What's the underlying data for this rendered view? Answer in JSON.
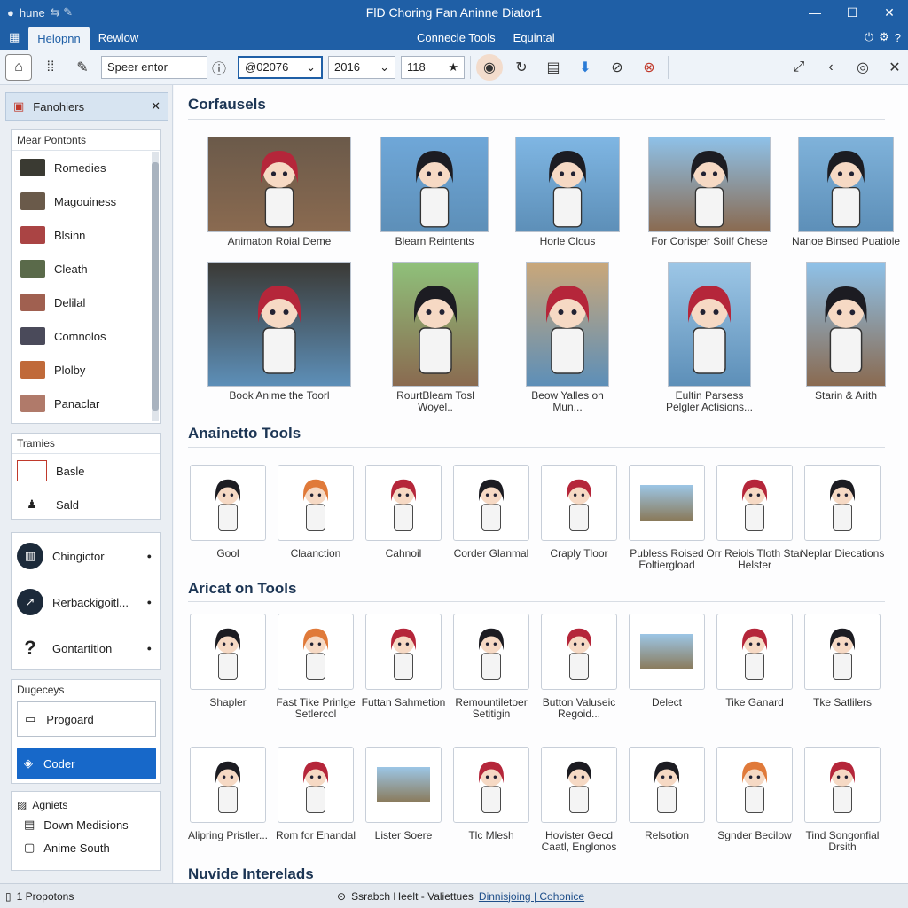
{
  "titlebar": {
    "app_label": "hune",
    "title": "FlD Choring Fan Aninne Diator1"
  },
  "menubar": {
    "tabs": [
      "Helopnn",
      "Rewlow"
    ],
    "center_items": [
      "Connecle Tools",
      "Equintal"
    ]
  },
  "toolbar": {
    "search_value": "Speer entor",
    "select1_value": "@02076",
    "select2_value": "2016",
    "number_value": "118"
  },
  "sidebar": {
    "top_title": "Fanohiers",
    "panel1_title": "Mear Pontonts",
    "panel1_items": [
      "Romedies",
      "Magouiness",
      "Blsinn",
      "Cleath",
      "Delilal",
      "Comnolos",
      "Plolby",
      "Panaclar"
    ],
    "panel2_title": "Tramies",
    "panel2_items": [
      "Basle",
      "Sald"
    ],
    "panel3_items": [
      "Chingictor",
      "Rerbackigoitl...",
      "Gontartition"
    ],
    "panel4_title": "Dugeceys",
    "panel4_buttons": [
      "Progoard",
      "Coder"
    ],
    "panel5_title": "Agniets",
    "panel5_items": [
      "Down Medisions",
      "Anime South"
    ]
  },
  "main": {
    "section1_title": "Corfausels",
    "section1_cards": [
      "Animaton Roial Deme",
      "Blearn Reintents",
      "Horle Clous",
      "For Corisper Soilf Chese",
      "Nanoe Binsed Puatiole",
      "Book Anime the Toorl",
      "RourtBleam Tosl Woyel..",
      "Beow Yalles on Mun...",
      "Eultin Parsess Pelgler Actisions...",
      "Starin & Arith"
    ],
    "section2_title": "Anainetto Tools",
    "section2_tiles": [
      "Gool",
      "Claanction",
      "Cahnoil",
      "Corder Glanmal",
      "Craply Tloor",
      "Publess Roised Eoltiergload",
      "Orr Reiols Tloth Star Helster",
      "Neplar Diecations"
    ],
    "section3_title": "Aricat on Tools",
    "section3_tiles": [
      "Shapler",
      "Fast Tike Prinlge Setlercol",
      "Futtan Sahmetion",
      "Remountiletoer Setitigin",
      "Button Valuseic Regoid...",
      "Delect",
      "Tike Ganard",
      "Tke Satlilers",
      "Alipring Pristler...",
      "Rom for Enandal",
      "Lister Soere",
      "Tlc Mlesh",
      "Hovister Gecd Caatl, Englonos",
      "Relsotion",
      "Sgnder Becilow",
      "Tind Songonfial Drsith"
    ],
    "section4_title": "Nuvide Interelads"
  },
  "statusbar": {
    "left": "1 Propotons",
    "center": "Ssrabch Heelt - Valiettues",
    "link": "Dinnisjoing | Cohonice"
  },
  "colors": {
    "accent": "#1f5fa6",
    "hair_red": "#b5263a",
    "hair_dark": "#1c1c22",
    "hair_orange": "#e07a3a"
  }
}
